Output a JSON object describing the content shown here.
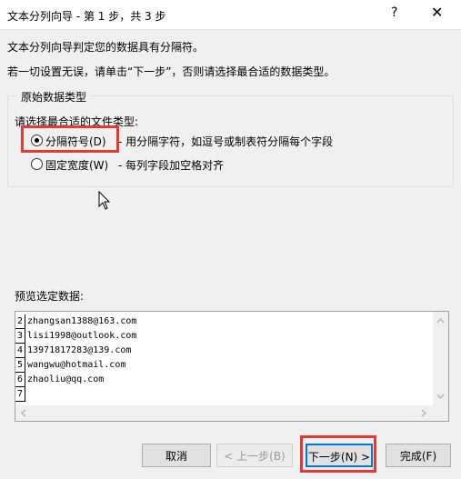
{
  "window": {
    "title": "文本分列向导 - 第 1 步，共 3 步",
    "help": "?",
    "close": "✕"
  },
  "intro": {
    "line1": "文本分列向导判定您的数据具有分隔符。",
    "line2": "若一切设置无误，请单击“下一步”，否则请选择最合适的数据类型。"
  },
  "group": {
    "legend": "原始数据类型",
    "prompt": "请选择最合适的文件类型:",
    "options": [
      {
        "label": "分隔符号(D)",
        "desc": "- 用分隔字符，如逗号或制表符分隔每个字段",
        "checked": true
      },
      {
        "label": "固定宽度(W)",
        "desc": "- 每列字段加空格对齐",
        "checked": false
      }
    ]
  },
  "preview": {
    "label": "预览选定数据:",
    "rows": [
      {
        "n": "2",
        "text": "zhangsan1388@163.com"
      },
      {
        "n": "3",
        "text": "lisi1998@outlook.com"
      },
      {
        "n": "4",
        "text": "13971817283@139.com"
      },
      {
        "n": "5",
        "text": "wangwu@hotmail.com"
      },
      {
        "n": "6",
        "text": "zhaoliu@qq.com"
      },
      {
        "n": "7",
        "text": ""
      }
    ]
  },
  "buttons": {
    "cancel": "取消",
    "back": "< 上一步(B)",
    "next": "下一步(N) >",
    "finish": "完成(F)"
  },
  "colors": {
    "highlight": "#e53935",
    "focus": "#0078d7"
  }
}
